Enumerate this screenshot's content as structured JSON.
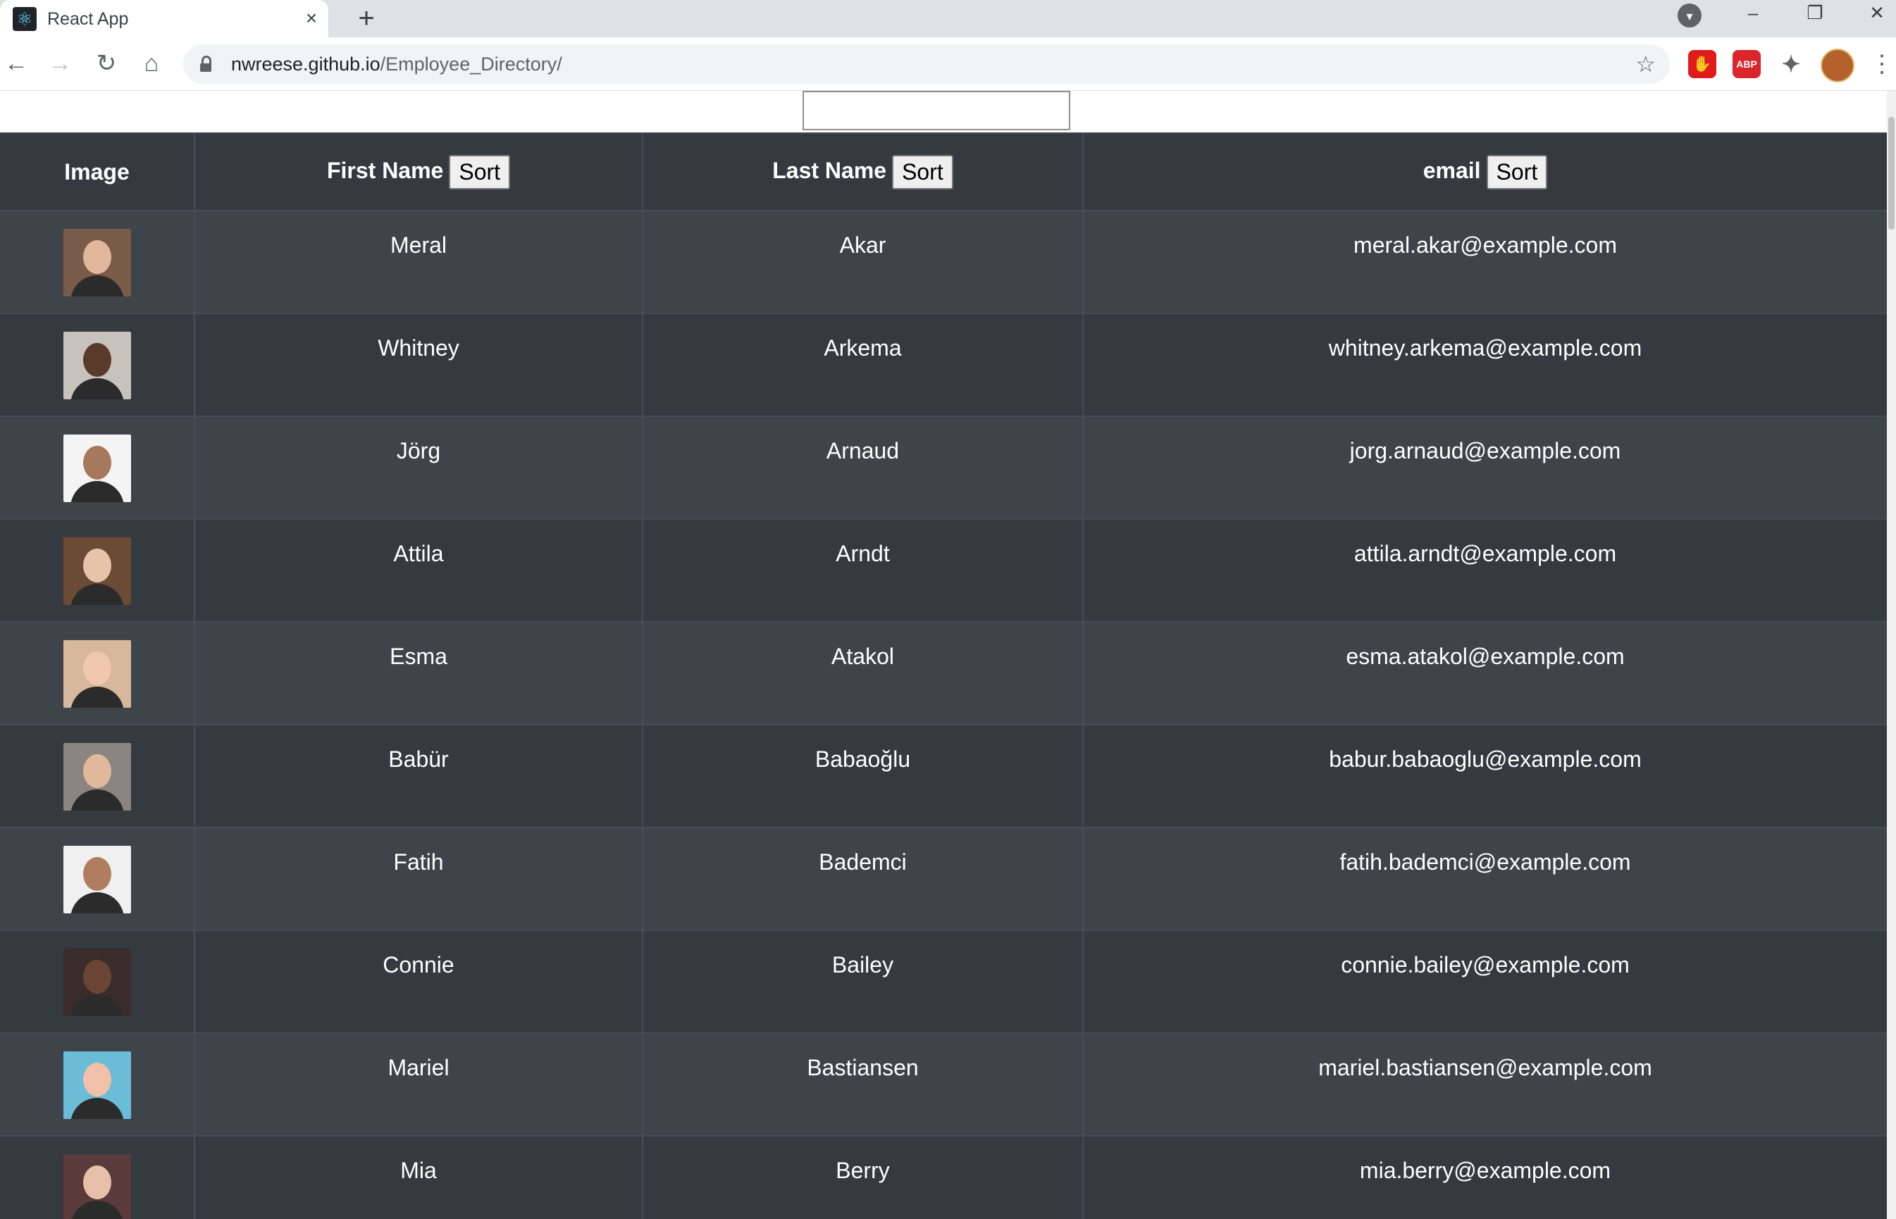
{
  "browser": {
    "tab_title": "React App",
    "new_tab": "+",
    "tab_close": "×",
    "url_host": "nwreese.github.io",
    "url_path": "/Employee_Directory/",
    "window_controls": {
      "minimize": "–",
      "restore": "❐",
      "close": "✕"
    },
    "extensions": {
      "ublock": "✋",
      "abp": "ABP",
      "puzzle": "✦"
    }
  },
  "search": {
    "value": "",
    "placeholder": ""
  },
  "table": {
    "headers": {
      "image": "Image",
      "first_name": "First Name",
      "last_name": "Last Name",
      "email": "email",
      "sort_label": "Sort"
    },
    "rows": [
      {
        "first": "Meral",
        "last": "Akar",
        "email": "meral.akar@example.com",
        "bg": "#7a5a48",
        "skin": "#e3b79c"
      },
      {
        "first": "Whitney",
        "last": "Arkema",
        "email": "whitney.arkema@example.com",
        "bg": "#c8c2bc",
        "skin": "#5a3a28"
      },
      {
        "first": "Jörg",
        "last": "Arnaud",
        "email": "jorg.arnaud@example.com",
        "bg": "#f4f4f4",
        "skin": "#a6785c"
      },
      {
        "first": "Attila",
        "last": "Arndt",
        "email": "attila.arndt@example.com",
        "bg": "#6b4a36",
        "skin": "#e6c4a8"
      },
      {
        "first": "Esma",
        "last": "Atakol",
        "email": "esma.atakol@example.com",
        "bg": "#d7b89c",
        "skin": "#efc8ae"
      },
      {
        "first": "Babür",
        "last": "Babaoğlu",
        "email": "babur.babaoglu@example.com",
        "bg": "#8a8580",
        "skin": "#e1b89b"
      },
      {
        "first": "Fatih",
        "last": "Bademci",
        "email": "fatih.bademci@example.com",
        "bg": "#f0f0f0",
        "skin": "#b07e5e"
      },
      {
        "first": "Connie",
        "last": "Bailey",
        "email": "connie.bailey@example.com",
        "bg": "#3a2c2a",
        "skin": "#6a4434"
      },
      {
        "first": "Mariel",
        "last": "Bastiansen",
        "email": "mariel.bastiansen@example.com",
        "bg": "#6bbcd6",
        "skin": "#f0c0a8"
      },
      {
        "first": "Mia",
        "last": "Berry",
        "email": "mia.berry@example.com",
        "bg": "#5a3a3a",
        "skin": "#e8c0aa"
      }
    ]
  }
}
